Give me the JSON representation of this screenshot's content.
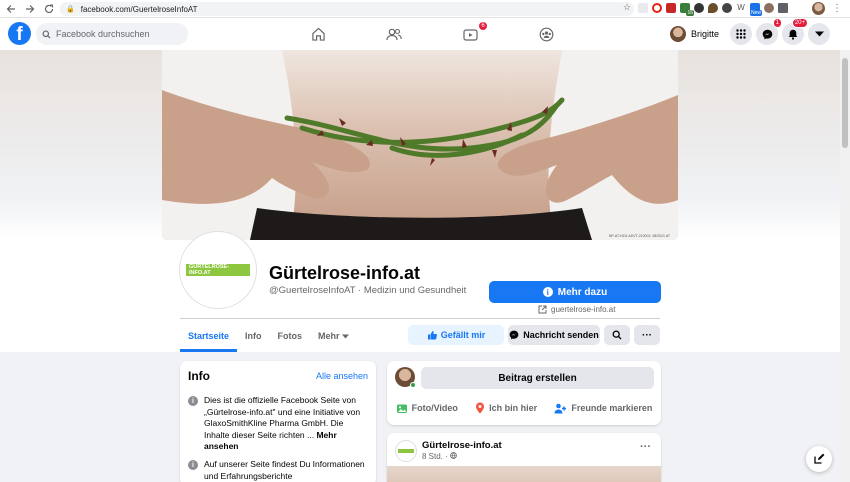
{
  "browser": {
    "url": "facebook.com/GuertelroseInfoAT",
    "extensions": [
      {
        "icon": "rocket-extension-icon",
        "color": "#5f6368"
      },
      {
        "icon": "opera-extension-icon",
        "color": "#e62117"
      },
      {
        "icon": "red-square-extension-icon",
        "color": "#c62828"
      },
      {
        "icon": "chart-extension-icon",
        "color": "#3b7d3b",
        "badge": "16"
      },
      {
        "icon": "dark-extension-icon",
        "color": "#333333"
      },
      {
        "icon": "leaf-extension-icon",
        "color": "#6b4f2b"
      },
      {
        "icon": "dots-extension-icon",
        "color": "#444444"
      },
      {
        "icon": "brown-extension-icon",
        "color": "#8d6e63"
      }
    ],
    "ext_w_label": "W",
    "ext_new_label": "New"
  },
  "topbar": {
    "logo": "f",
    "search_placeholder": "Facebook durchsuchen",
    "watch_badge": "6",
    "user_name": "Brigitte",
    "messenger_badge": "1",
    "notifications_badge": "20+"
  },
  "page": {
    "title": "Gürtelrose-info.at",
    "subtitle": "@GuertelroseInfoAT · Medizin und Gesundheit",
    "logo_text": "GÜRTELROSE-INFO.AT",
    "cta_label": "Mehr dazu",
    "external_link": "guertelrose-info.at",
    "cover_caption": "NP-AT-HZU-ADVT-210002, 08/2021 AT"
  },
  "tabs": [
    {
      "label": "Startseite",
      "active": true
    },
    {
      "label": "Info"
    },
    {
      "label": "Fotos"
    },
    {
      "label": "Mehr"
    }
  ],
  "actions": {
    "like": "Gefällt mir",
    "message": "Nachricht senden",
    "more": "···"
  },
  "info_card": {
    "title": "Info",
    "see_all": "Alle ansehen",
    "item1_text": "Dies ist die offizielle Facebook Seite von „Gürtelrose-info.at\" und eine Initiative von GlaxoSmithKline Pharma GmbH. Die Inhalte dieser Seite richten ...",
    "item1_more": "Mehr ansehen",
    "item2_text": "Auf unserer Seite findest Du Informationen und Erfahrungsberichte"
  },
  "composer": {
    "create_post": "Beitrag erstellen",
    "photo_video": "Foto/Video",
    "checkin": "Ich bin hier",
    "tag_friends": "Freunde markieren"
  },
  "post": {
    "author": "Gürtelrose-info.at",
    "time": "8 Std. ·",
    "more": "···"
  },
  "colors": {
    "fb_blue": "#1877f2",
    "brand_green": "#8dc63f",
    "badge_red": "#e41e3f"
  }
}
